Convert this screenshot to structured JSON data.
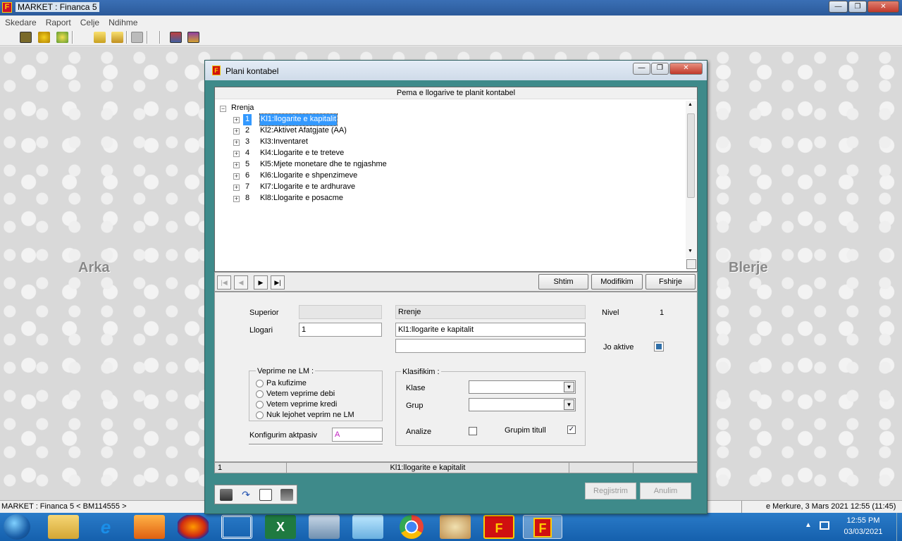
{
  "app": {
    "title": "MARKET : Financa 5",
    "icon_letter": "F"
  },
  "window_controls": {
    "minimize": "—",
    "restore": "❐",
    "close": "✕"
  },
  "menu": [
    "Skedare",
    "Raport",
    "Celje",
    "Ndihme"
  ],
  "toolbar_icons": [
    "book-binoculars-icon",
    "coins-icon",
    "add-icon",
    "folder-open-icon",
    "folder-up-icon",
    "disk-icon",
    "report-icon",
    "book-icon"
  ],
  "desktop": {
    "left_label": "Arka",
    "right_label": "Blerje"
  },
  "status": {
    "left": "MARKET : Financa 5  < BM114555 >",
    "right": "e Merkure, 3 Mars 2021 12:55  (11:45)"
  },
  "taskbar": {
    "time": "12:55 PM",
    "date": "03/03/2021",
    "apps": [
      "file-explorer-icon",
      "internet-explorer-icon",
      "media-player-icon",
      "firefox-icon",
      "maze-app-icon",
      "excel-icon",
      "calculator-icon",
      "notepad-icon",
      "chrome-icon",
      "paint-icon",
      "financa-f5-icon",
      "financa-f5-active-icon"
    ]
  },
  "dialog": {
    "title": "Plani kontabel",
    "tree_header": "Pema e llogarive te planit kontabel",
    "root_label": "Rrenja",
    "items": [
      {
        "num": "1",
        "label": "Kl1:llogarite e kapitalit",
        "selected": true
      },
      {
        "num": "2",
        "label": "Kl2:Aktivet Afatgjate (AA)"
      },
      {
        "num": "3",
        "label": "Kl3:Inventaret"
      },
      {
        "num": "4",
        "label": "Kl4:Llogarite e te treteve"
      },
      {
        "num": "5",
        "label": "Kl5:Mjete monetare dhe te ngjashme"
      },
      {
        "num": "6",
        "label": "Kl6:Llogarite e shpenzimeve"
      },
      {
        "num": "7",
        "label": "Kl7:Llogarite e te ardhurave"
      },
      {
        "num": "8",
        "label": "Kl8:Llogarite e posacme"
      }
    ],
    "nav": {
      "first": "|◀",
      "prev": "◀",
      "next": "▶",
      "last": "▶|"
    },
    "actions": {
      "add": "Shtim",
      "modify": "Modifikim",
      "delete": "Fshirje"
    },
    "form": {
      "superior_label": "Superior",
      "superior_value": "",
      "superior_name": "Rrenje",
      "account_label": "Llogari",
      "account_value": "1",
      "account_name": "Kl1:llogarite e kapitalit",
      "account_name2": "",
      "level_label": "Nivel",
      "level_value": "1",
      "inactive_label": "Jo aktive",
      "ops_title": "Veprime ne LM :",
      "ops": [
        "Pa kufizime",
        "Vetem veprime debi",
        "Vetem veprime kredi",
        "Nuk lejohet veprim ne LM"
      ],
      "config_label": "Konfigurim aktpasiv",
      "config_value": "A",
      "class_title": "Klasifikim :",
      "class_label": "Klase",
      "class_value": "",
      "group_label": "Grup",
      "group_value": "",
      "analysis_label": "Analize",
      "analysis_checked": false,
      "group_title_label": "Grupim titull",
      "group_title_checked": true
    },
    "infobar": {
      "code": "1",
      "name": "Kl1:llogarite e kapitalit"
    },
    "bottom_tools": [
      "filter-icon",
      "undo-icon",
      "edit-icon",
      "print-icon"
    ],
    "buttons": {
      "register": "Regjistrim",
      "cancel": "Anulim"
    }
  }
}
